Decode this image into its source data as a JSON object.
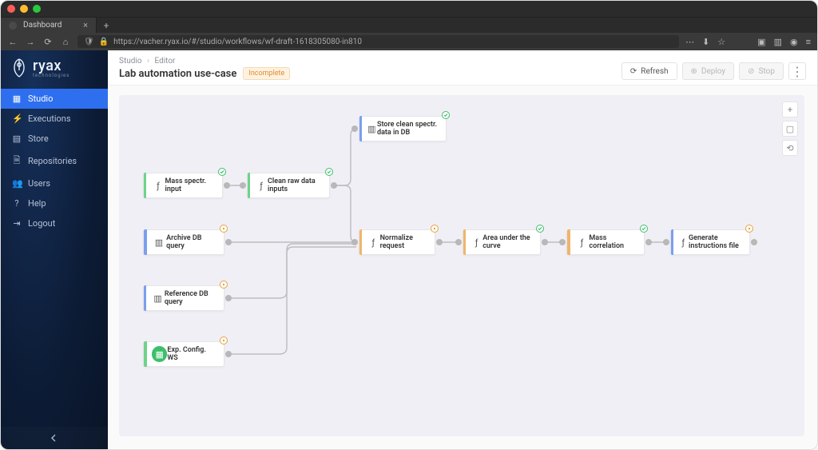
{
  "browser": {
    "tab_title": "Dashboard",
    "url": "https://vacher.ryax.io/#/studio/workflows/wf-draft-1618305080-in810"
  },
  "brand": {
    "name": "ryax",
    "sub": "technologies"
  },
  "sidebar": {
    "items": [
      {
        "label": "Studio"
      },
      {
        "label": "Executions"
      },
      {
        "label": "Store"
      },
      {
        "label": "Repositories"
      },
      {
        "label": "Users"
      },
      {
        "label": "Help"
      },
      {
        "label": "Logout"
      }
    ]
  },
  "header": {
    "crumb1": "Studio",
    "crumb2": "Editor",
    "title": "Lab automation use-case",
    "status_badge": "Incomplete",
    "actions": {
      "refresh": "Refresh",
      "deploy": "Deploy",
      "stop": "Stop"
    }
  },
  "workflow": {
    "nodes": {
      "mass_input": {
        "label": "Mass spectr. input",
        "accent": "#6fd28a",
        "icon": "fn",
        "status": "ok"
      },
      "clean_raw": {
        "label": "Clean raw data inputs",
        "accent": "#6fd28a",
        "icon": "fn",
        "status": "ok"
      },
      "store_clean": {
        "label": "Store clean spectr. data in DB",
        "accent": "#7a9ff0",
        "icon": "db",
        "status": "ok"
      },
      "archive_q": {
        "label": "Archive DB query",
        "accent": "#7a9ff0",
        "icon": "db",
        "status": "warn"
      },
      "reference_q": {
        "label": "Reference DB query",
        "accent": "#7a9ff0",
        "icon": "db",
        "status": "warn"
      },
      "exp_config": {
        "label": "Exp. Config. WS",
        "accent": "#6fd28a",
        "icon": "ws",
        "status": "warn"
      },
      "normalize": {
        "label": "Normalize request",
        "accent": "#efb56b",
        "icon": "fn",
        "status": "warn"
      },
      "auc": {
        "label": "Area under the curve",
        "accent": "#efb56b",
        "icon": "fn",
        "status": "ok"
      },
      "mass_corr": {
        "label": "Mass correlation",
        "accent": "#efb56b",
        "icon": "fn",
        "status": "ok"
      },
      "gen_instr": {
        "label": "Generate instructions file",
        "accent": "#7a9ff0",
        "icon": "fn",
        "status": "warn"
      }
    }
  }
}
